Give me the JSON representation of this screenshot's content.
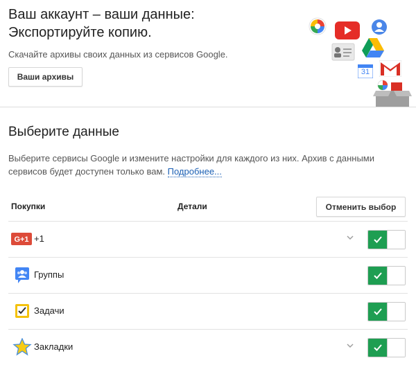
{
  "hero": {
    "title_line1": "Ваш аккаунт – ваши данные:",
    "title_line2": "Экспортируйте копию.",
    "subtitle": "Скачайте архивы своих данных из сервисов Google.",
    "archives_button": "Ваши архивы"
  },
  "illustration": {
    "calendar_number": "31"
  },
  "select_data": {
    "title": "Выберите данные",
    "description": "Выберите сервисы Google и измените настройки для каждого из них. Архив с данными сервисов будет доступен только вам.",
    "more_link": "Подробнее..."
  },
  "table": {
    "col_purchases": "Покупки",
    "col_details": "Детали",
    "deselect_button": "Отменить выбор",
    "rows": [
      {
        "label": "+1",
        "icon": "google-plus-one-icon",
        "icon_text": "G+1",
        "has_details": true,
        "enabled": true
      },
      {
        "label": "Группы",
        "icon": "groups-icon",
        "has_details": false,
        "enabled": true
      },
      {
        "label": "Задачи",
        "icon": "tasks-icon",
        "has_details": false,
        "enabled": true
      },
      {
        "label": "Закладки",
        "icon": "bookmarks-star-icon",
        "has_details": true,
        "enabled": true
      }
    ]
  },
  "colors": {
    "toggle_on": "#1e9e52",
    "link": "#1a5fb4",
    "gplus_red": "#dd4b39",
    "groups_blue": "#4285f4",
    "tasks_yellow": "#f4c20d"
  }
}
